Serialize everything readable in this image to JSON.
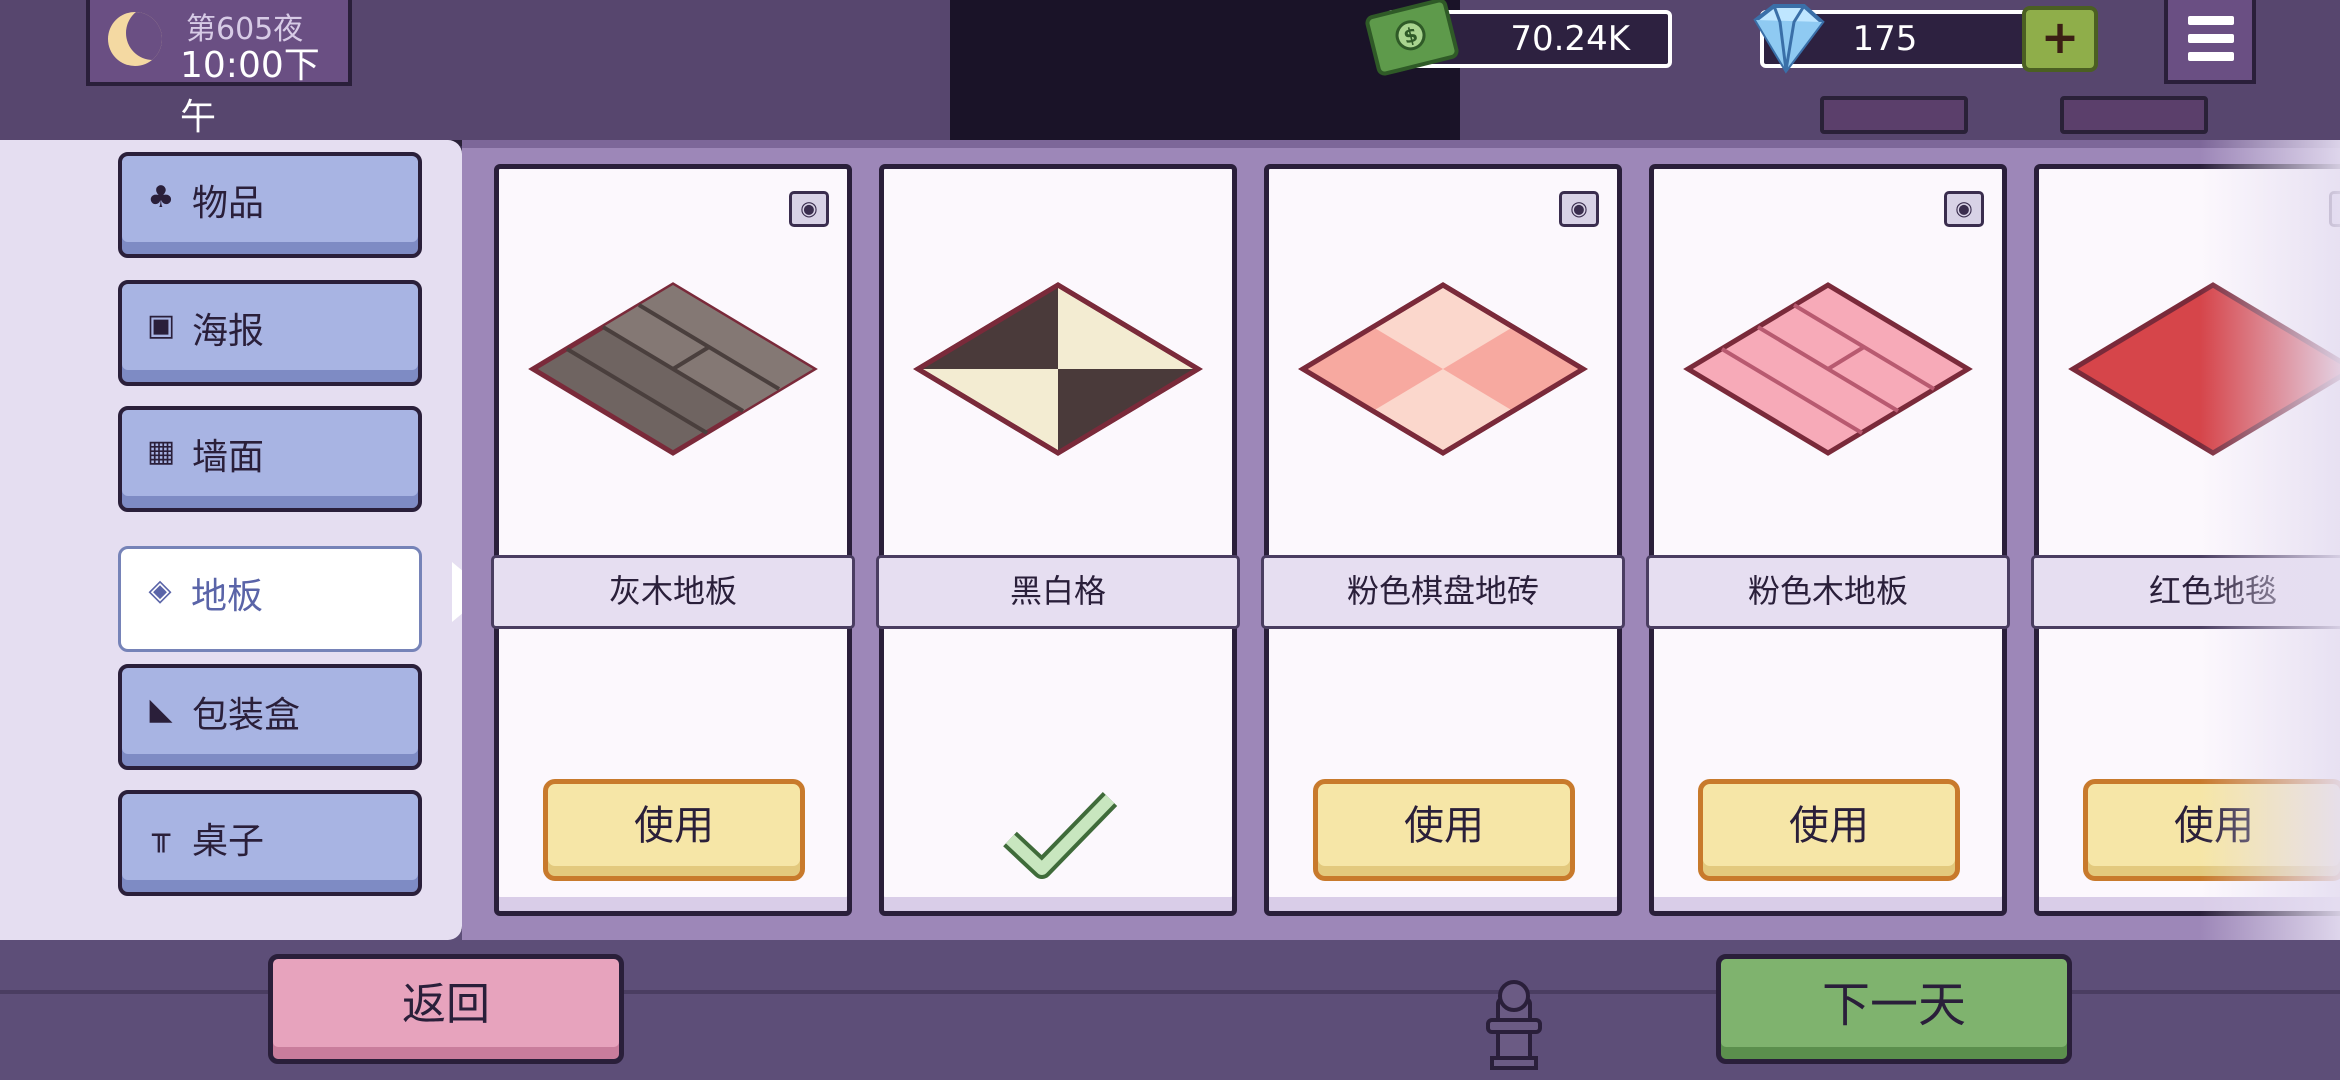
{
  "hud": {
    "night": "第605夜",
    "time": "10:00下午",
    "money": "70.24K",
    "gems": "175",
    "plus_label": "+"
  },
  "categories": [
    {
      "label": "物品",
      "icon": "plant-pot-icon"
    },
    {
      "label": "海报",
      "icon": "picture-icon"
    },
    {
      "label": "墙面",
      "icon": "wall-bricks-icon"
    },
    {
      "label": "地板",
      "icon": "floor-tiles-icon",
      "active": true
    },
    {
      "label": "包装盒",
      "icon": "pizza-slice-icon"
    },
    {
      "label": "桌子",
      "icon": "table-icon"
    }
  ],
  "items": [
    {
      "name": "灰木地板",
      "action": "使用",
      "in_use": false,
      "has_preview": true
    },
    {
      "name": "黑白格",
      "action": "",
      "in_use": true,
      "has_preview": false
    },
    {
      "name": "粉色棋盘地砖",
      "action": "使用",
      "in_use": false,
      "has_preview": true
    },
    {
      "name": "粉色木地板",
      "action": "使用",
      "in_use": false,
      "has_preview": true
    },
    {
      "name": "红色地毯",
      "action": "使用",
      "in_use": false,
      "has_preview": true
    }
  ],
  "bottom": {
    "back_label": "返回",
    "next_day_label": "下一天"
  },
  "colors": {
    "panel_bg": "#9d87b8",
    "side_bg": "#e5def1",
    "category_button": "#a8b4e3",
    "use_button": "#f6e6a7",
    "back_button": "#e7a3bd",
    "next_day_button": "#7fb36e"
  }
}
